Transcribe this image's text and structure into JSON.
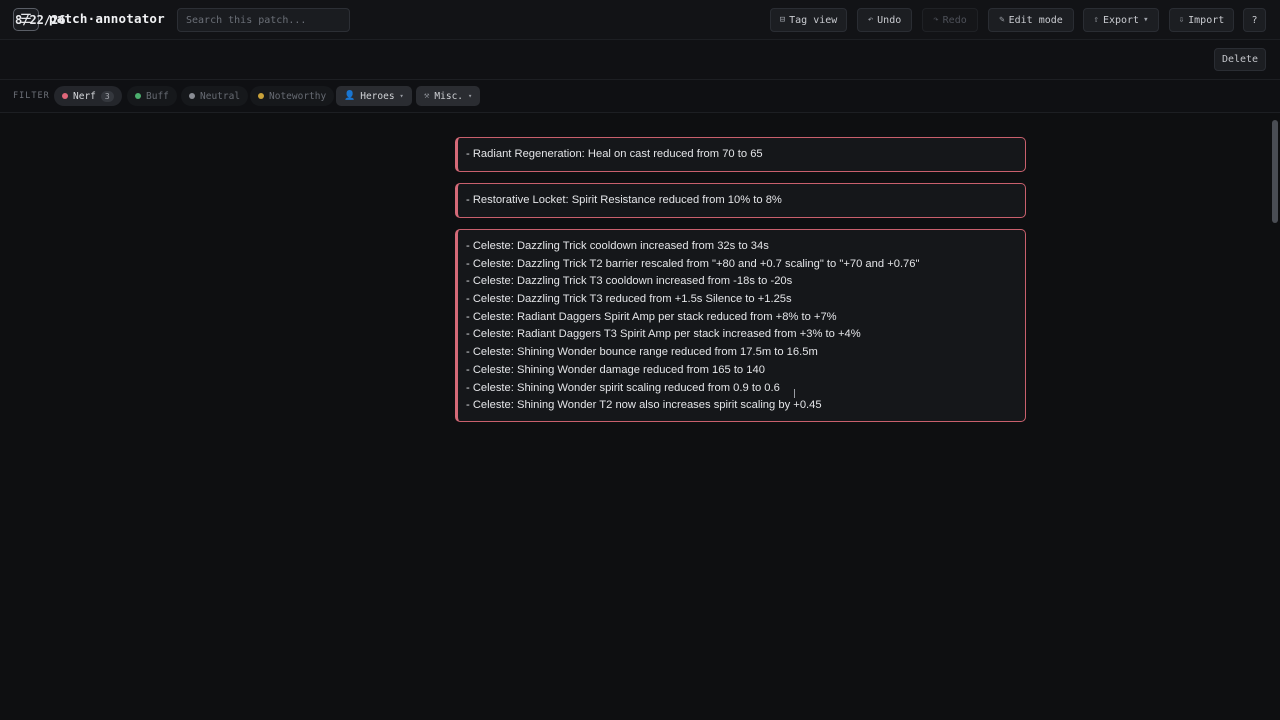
{
  "app": {
    "title": "patch·annotator",
    "search_placeholder": "Search this patch..."
  },
  "toolbar": {
    "tag_view": "Tag view",
    "undo": "Undo",
    "redo": "Redo",
    "edit_mode": "Edit mode",
    "export": "Export",
    "import": "Import",
    "help": "?"
  },
  "patch": {
    "date": "8/22/26",
    "delete_label": "Delete"
  },
  "filter": {
    "label": "FILTER",
    "chips": [
      {
        "label": "Nerf",
        "count": "3",
        "color": "#e0677a",
        "active": true
      },
      {
        "label": "Buff",
        "color": "#4caf6e",
        "active": false
      },
      {
        "label": "Neutral",
        "color": "#8a8d94",
        "active": false
      },
      {
        "label": "Noteworthy",
        "color": "#c9a23a",
        "active": false
      }
    ],
    "heroes_label": "Heroes",
    "misc_label": "Misc."
  },
  "cards": [
    {
      "lines": [
        "- Radiant Regeneration: Heal on cast reduced from 70 to 65"
      ]
    },
    {
      "lines": [
        "- Restorative Locket: Spirit Resistance reduced from 10% to 8%"
      ]
    },
    {
      "lines": [
        "- Celeste: Dazzling Trick cooldown increased from 32s to 34s",
        "- Celeste: Dazzling Trick T2 barrier rescaled from \"+80 and +0.7 scaling\" to \"+70 and +0.76\"",
        "- Celeste: Dazzling Trick T3 cooldown increased from -18s to -20s",
        "- Celeste: Dazzling Trick T3 reduced from +1.5s Silence to +1.25s",
        "- Celeste: Radiant Daggers Spirit Amp per stack reduced from +8% to +7%",
        "- Celeste: Radiant Daggers T3 Spirit Amp per stack increased from +3% to +4%",
        "- Celeste: Shining Wonder bounce range reduced from 17.5m to 16.5m",
        "- Celeste: Shining Wonder damage reduced from 165 to 140",
        "- Celeste: Shining Wonder spirit scaling reduced from 0.9 to 0.6",
        "- Celeste: Shining Wonder T2 now also increases spirit scaling by +0.45"
      ]
    }
  ],
  "colors": {
    "nerf_border": "#c9606d",
    "background": "#0e0f11"
  }
}
